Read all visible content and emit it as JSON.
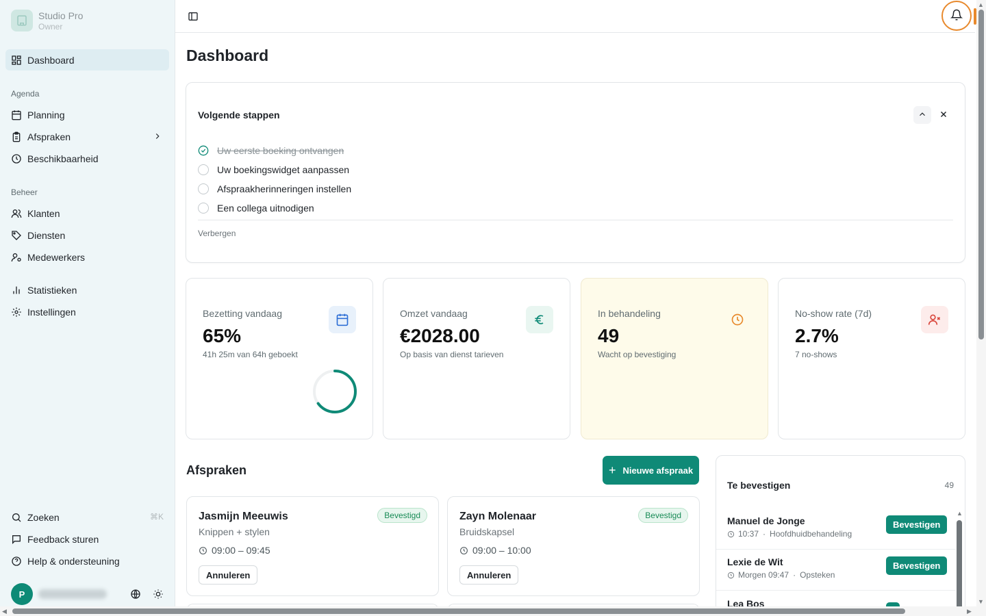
{
  "brand": {
    "name": "Studio Pro",
    "role": "Owner"
  },
  "sidebar": {
    "dashboard": "Dashboard",
    "section_agenda": "Agenda",
    "planning": "Planning",
    "appointments": "Afspraken",
    "availability": "Beschikbaarheid",
    "section_manage": "Beheer",
    "clients": "Klanten",
    "services": "Diensten",
    "staff": "Medewerkers",
    "statistics": "Statistieken",
    "settings": "Instellingen",
    "search": "Zoeken",
    "search_shortcut": "⌘K",
    "feedback": "Feedback sturen",
    "help": "Help & ondersteuning",
    "user_initial": "P"
  },
  "page": {
    "title": "Dashboard"
  },
  "next_steps": {
    "title": "Volgende stappen",
    "items": [
      {
        "label": "Uw eerste boeking ontvangen",
        "done": true
      },
      {
        "label": "Uw boekingswidget aanpassen",
        "done": false
      },
      {
        "label": "Afspraakherinneringen instellen",
        "done": false
      },
      {
        "label": "Een collega uitnodigen",
        "done": false
      }
    ],
    "hide_label": "Verbergen"
  },
  "stats": [
    {
      "label": "Bezetting vandaag",
      "value": "65%",
      "sub": "41h 25m van 64h geboekt",
      "icon": "calendar-icon",
      "fraction": 0.65
    },
    {
      "label": "Omzet vandaag",
      "value": "€2028.00",
      "sub": "Op basis van dienst tarieven",
      "icon": "euro-icon"
    },
    {
      "label": "In behandeling",
      "value": "49",
      "sub": "Wacht op bevestiging",
      "icon": "clock-icon"
    },
    {
      "label": "No-show rate (7d)",
      "value": "2.7%",
      "sub": "7 no-shows",
      "icon": "user-x-icon"
    }
  ],
  "appointments": {
    "title": "Afspraken",
    "new_button": "Nieuwe afspraak",
    "cards": [
      {
        "name": "Jasmijn Meeuwis",
        "service": "Knippen + stylen",
        "time": "09:00 – 09:45",
        "status": "Bevestigd",
        "cancel": "Annuleren"
      },
      {
        "name": "Zayn Molenaar",
        "service": "Bruidskapsel",
        "time": "09:00 – 10:00",
        "status": "Bevestigd",
        "cancel": "Annuleren"
      }
    ]
  },
  "to_confirm": {
    "title": "Te bevestigen",
    "count": "49",
    "button": "Bevestigen",
    "rows": [
      {
        "name": "Manuel de Jonge",
        "time": "10:37",
        "service": "Hoofdhuidbehandeling"
      },
      {
        "name": "Lexie de Wit",
        "time": "Morgen 09:47",
        "service": "Opsteken"
      },
      {
        "name": "Lea Bos",
        "time": "",
        "service": ""
      }
    ]
  },
  "colors": {
    "accent": "#0f8a77",
    "highlight": "#e8892c",
    "pending_bg": "#fefbea"
  }
}
